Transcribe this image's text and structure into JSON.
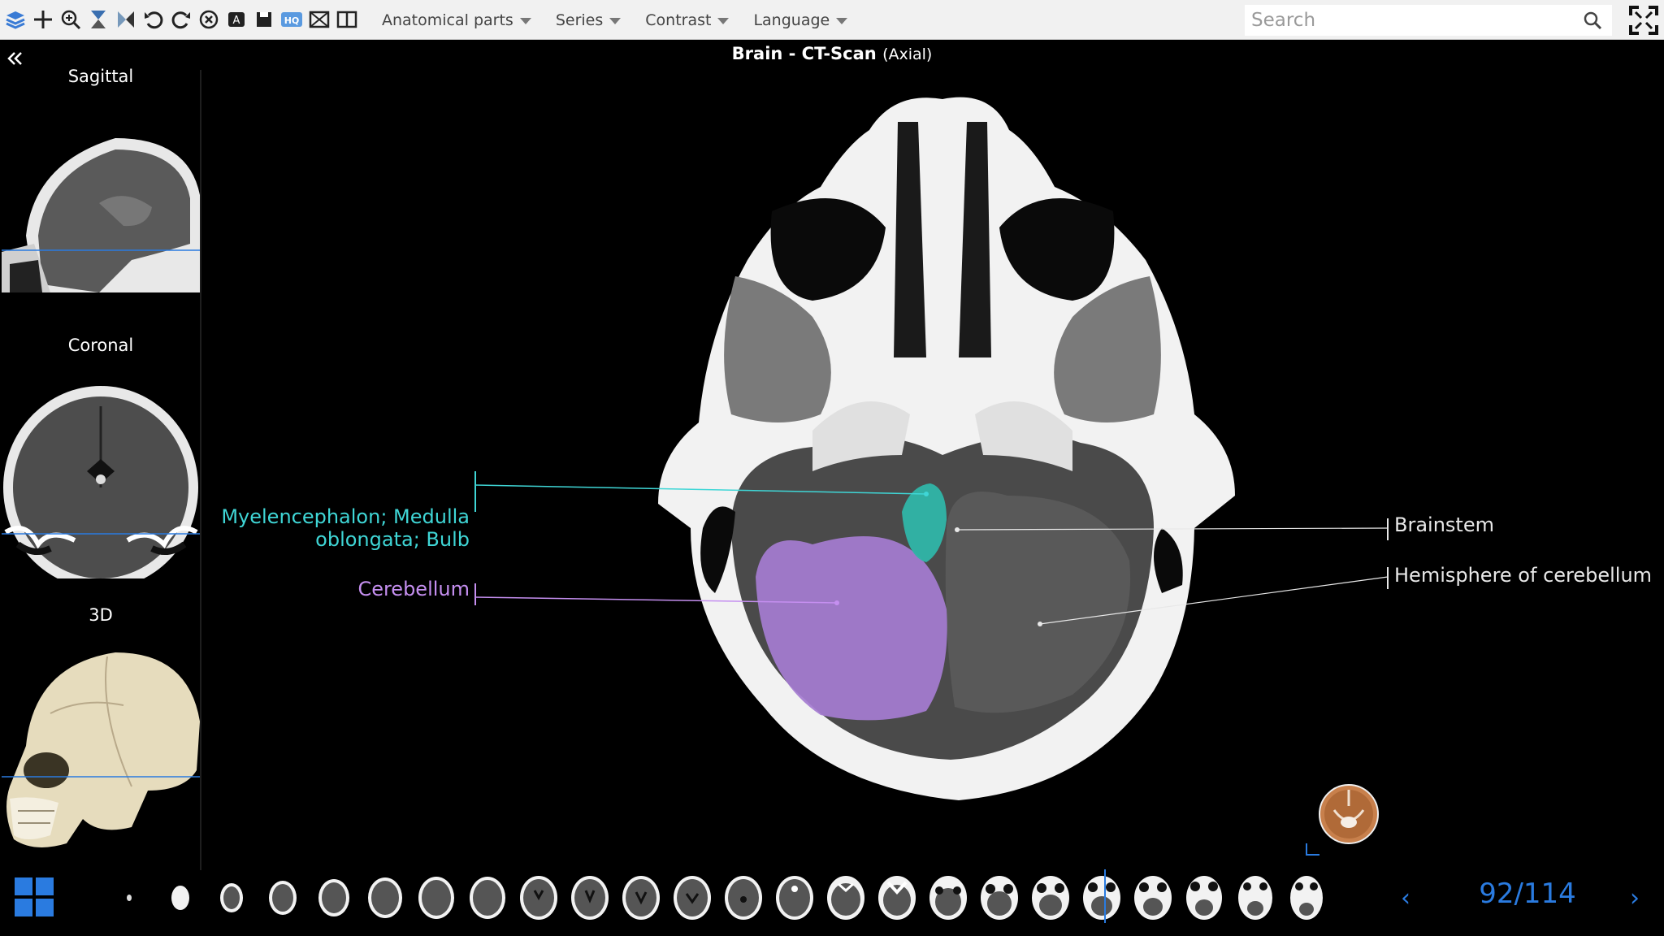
{
  "toolbar": {
    "icons": [
      "layers-icon",
      "crosshair-move-icon",
      "zoom-icon",
      "slice-scroll-icon",
      "play-icon",
      "rotate-left-icon",
      "rotate-right-icon",
      "reset-icon",
      "annotation-text-icon",
      "save-icon",
      "hq-icon",
      "screenshot-icon",
      "split-view-icon"
    ],
    "menus": {
      "anatomical_parts": "Anatomical parts",
      "series": "Series",
      "contrast": "Contrast",
      "language": "Language"
    },
    "search_placeholder": "Search"
  },
  "title": {
    "main": "Brain - CT-Scan",
    "sub": "(Axial)"
  },
  "sidebar": {
    "views": [
      {
        "label": "Sagittal"
      },
      {
        "label": "Coronal"
      },
      {
        "label": "3D"
      }
    ]
  },
  "labels": {
    "medulla_line1": "Myelencephalon; Medulla",
    "medulla_line2": "oblongata; Bulb",
    "cerebellum": "Cerebellum",
    "brainstem": "Brainstem",
    "hemisphere": "Hemisphere of cerebellum"
  },
  "colors": {
    "medulla": "#3fd6d6",
    "cerebellum": "#c58ff0",
    "right_labels": "#e8e8e8",
    "accent": "#2a7be0"
  },
  "navigation": {
    "current_slice": 92,
    "total_slices": 114,
    "counter": "92/114",
    "prev": "‹",
    "next": "›"
  }
}
